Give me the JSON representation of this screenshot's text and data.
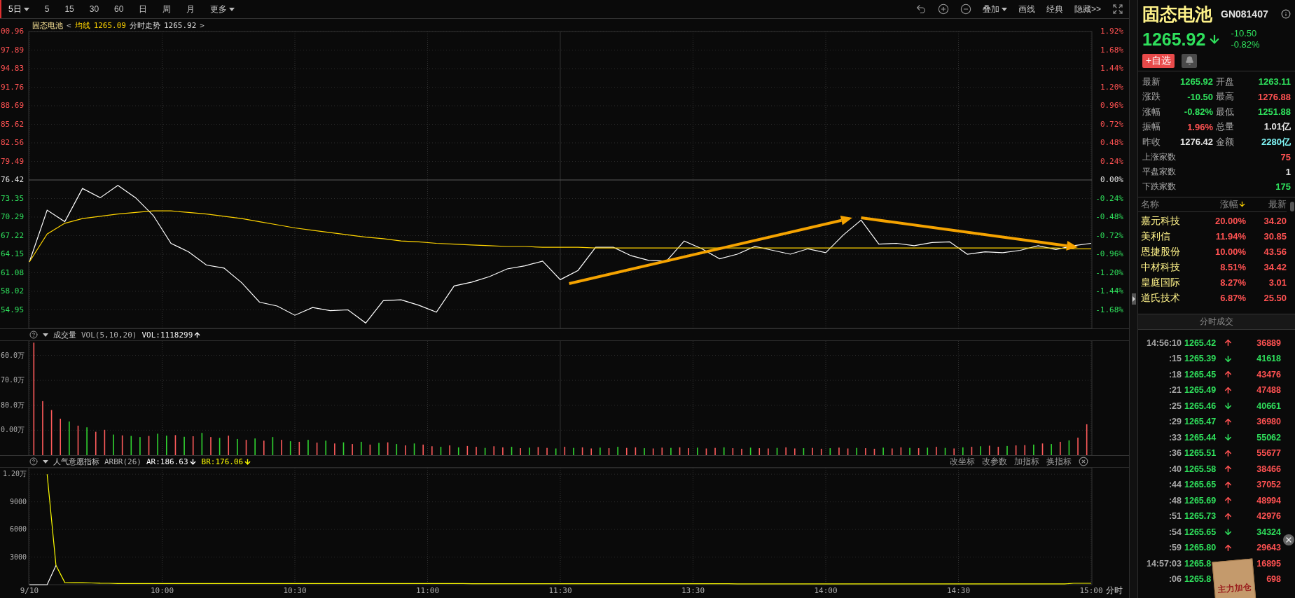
{
  "toolbar": {
    "periods": [
      {
        "label": "5日",
        "selected": true,
        "dropdown": true
      },
      {
        "label": "5",
        "selected": false,
        "dropdown": false
      },
      {
        "label": "15",
        "selected": false,
        "dropdown": false
      },
      {
        "label": "30",
        "selected": false,
        "dropdown": false
      },
      {
        "label": "60",
        "selected": false,
        "dropdown": false
      },
      {
        "label": "日",
        "selected": false,
        "dropdown": false
      },
      {
        "label": "周",
        "selected": false,
        "dropdown": false
      },
      {
        "label": "月",
        "selected": false,
        "dropdown": false
      },
      {
        "label": "更多",
        "selected": false,
        "dropdown": true
      }
    ],
    "tools": [
      {
        "kind": "undo"
      },
      {
        "kind": "zoom_in"
      },
      {
        "kind": "zoom_out"
      },
      {
        "kind": "text",
        "label": "叠加",
        "dropdown": true
      },
      {
        "kind": "text",
        "label": "画线",
        "dropdown": false
      },
      {
        "kind": "text",
        "label": "经典",
        "dropdown": false
      },
      {
        "kind": "text",
        "label": "隐藏>>",
        "dropdown": false
      },
      {
        "kind": "fullscreen"
      }
    ]
  },
  "main_chart": {
    "legend": {
      "name": "固态电池",
      "open": "<",
      "avg_value": "1265.09",
      "trend_value": "1265.92",
      "close": ">"
    },
    "price_labels": [
      "00.96",
      "97.89",
      "94.83",
      "91.76",
      "88.69",
      "85.62",
      "82.56",
      "79.49",
      "76.42",
      "73.35",
      "70.29",
      "67.22",
      "64.15",
      "61.08",
      "58.02",
      "54.95"
    ],
    "chart_data": {
      "type": "line",
      "grid": true,
      "ylim": [
        -1.92,
        1.92
      ],
      "yticks": [
        {
          "value": 1.92,
          "label": "1.92%"
        },
        {
          "value": 1.68,
          "label": "1.68%"
        },
        {
          "value": 1.44,
          "label": "1.44%"
        },
        {
          "value": 1.2,
          "label": "1.20%"
        },
        {
          "value": 0.96,
          "label": "0.96%"
        },
        {
          "value": 0.72,
          "label": "0.72%"
        },
        {
          "value": 0.48,
          "label": "0.48%"
        },
        {
          "value": 0.24,
          "label": "0.24%"
        },
        {
          "value": 0,
          "label": "0.00%"
        },
        {
          "value": -0.24,
          "label": "-0.24%"
        },
        {
          "value": -0.48,
          "label": "-0.48%"
        },
        {
          "value": -0.72,
          "label": "-0.72%"
        },
        {
          "value": -0.96,
          "label": "-0.96%"
        },
        {
          "value": -1.2,
          "label": "-1.20%"
        },
        {
          "value": -1.44,
          "label": "-1.44%"
        },
        {
          "value": -1.68,
          "label": "-1.68%"
        }
      ],
      "categories": [
        null,
        null,
        null,
        null,
        null,
        null,
        null,
        null,
        null,
        null,
        null,
        null,
        null,
        null,
        null,
        null,
        null,
        null,
        null,
        null,
        null,
        null,
        null,
        null,
        null,
        null,
        null,
        null,
        null,
        null,
        null,
        null,
        null,
        null,
        null,
        null,
        null,
        null,
        null,
        null,
        null,
        null,
        null,
        null,
        null,
        null,
        null,
        null,
        null,
        null,
        null,
        null,
        null,
        null,
        null,
        null,
        null,
        null,
        null,
        null,
        null
      ],
      "series": [
        {
          "name": "分时走势",
          "color": "#ffffff",
          "values": [
            -1.06,
            -0.39,
            -0.54,
            -0.11,
            -0.23,
            -0.07,
            -0.23,
            -0.46,
            -0.82,
            -0.93,
            -1.1,
            -1.14,
            -1.33,
            -1.58,
            -1.63,
            -1.75,
            -1.65,
            -1.69,
            -1.68,
            -1.85,
            -1.56,
            -1.55,
            -1.62,
            -1.71,
            -1.37,
            -1.32,
            -1.25,
            -1.15,
            -1.11,
            -1.05,
            -1.29,
            -1.17,
            -0.87,
            -0.87,
            -0.98,
            -1.04,
            -1.05,
            -0.79,
            -0.89,
            -1.02,
            -0.96,
            -0.86,
            -0.91,
            -0.96,
            -0.89,
            -0.94,
            -0.71,
            -0.52,
            -0.83,
            -0.82,
            -0.85,
            -0.81,
            -0.8,
            -0.96,
            -0.93,
            -0.94,
            -0.91,
            -0.85,
            -0.9,
            -0.85,
            -0.82
          ]
        },
        {
          "name": "均线",
          "color": "#ffd400",
          "values": [
            -1.06,
            -0.7,
            -0.56,
            -0.5,
            -0.47,
            -0.44,
            -0.42,
            -0.4,
            -0.4,
            -0.42,
            -0.44,
            -0.47,
            -0.5,
            -0.54,
            -0.58,
            -0.62,
            -0.65,
            -0.68,
            -0.71,
            -0.74,
            -0.76,
            -0.79,
            -0.8,
            -0.82,
            -0.83,
            -0.84,
            -0.85,
            -0.86,
            -0.86,
            -0.87,
            -0.87,
            -0.87,
            -0.88,
            -0.88,
            -0.88,
            -0.88,
            -0.88,
            -0.88,
            -0.88,
            -0.88,
            -0.88,
            -0.88,
            -0.88,
            -0.88,
            -0.88,
            -0.88,
            -0.88,
            -0.88,
            -0.88,
            -0.88,
            -0.88,
            -0.88,
            -0.88,
            -0.88,
            -0.88,
            -0.88,
            -0.88,
            -0.88,
            -0.88,
            -0.89,
            -0.89
          ]
        }
      ]
    }
  },
  "volume_panel": {
    "title": "成交量",
    "params": "VOL(5,10,20)",
    "reading": "VOL:1118299",
    "reading_rising": true,
    "axis_labels": [
      "60.0万",
      "70.0万",
      "80.0万",
      "0.00万"
    ]
  },
  "arbr_panel": {
    "title": "人气意愿指标",
    "params": "ARBR(26)",
    "readings": [
      {
        "text": "AR:186.63",
        "rising": false
      },
      {
        "text": "BR:176.06",
        "rising": false
      }
    ],
    "actions": [
      "改坐标",
      "改参数",
      "加指标",
      "换指标"
    ],
    "x_unit": "分时",
    "top_label": "1.20万",
    "chart_data": {
      "type": "line",
      "grid": true,
      "ylim": [
        0,
        12700
      ],
      "yticks": [
        9000,
        6000,
        3000
      ],
      "categories": [
        "9/10",
        null,
        null,
        null,
        null,
        null,
        null,
        null,
        null,
        null,
        null,
        null,
        null,
        null,
        null,
        "10:00",
        null,
        null,
        null,
        null,
        null,
        null,
        null,
        null,
        null,
        null,
        null,
        null,
        null,
        null,
        "10:30",
        null,
        null,
        null,
        null,
        null,
        null,
        null,
        null,
        null,
        null,
        null,
        null,
        null,
        null,
        "11:00",
        null,
        null,
        null,
        null,
        null,
        null,
        null,
        null,
        null,
        null,
        null,
        null,
        null,
        null,
        "11:30",
        null,
        null,
        null,
        null,
        null,
        null,
        null,
        null,
        null,
        null,
        null,
        null,
        null,
        null,
        "13:30",
        null,
        null,
        null,
        null,
        null,
        null,
        null,
        null,
        null,
        null,
        null,
        null,
        null,
        null,
        "14:00",
        null,
        null,
        null,
        null,
        null,
        null,
        null,
        null,
        null,
        null,
        null,
        null,
        null,
        null,
        "14:30",
        null,
        null,
        null,
        null,
        null,
        null,
        null,
        null,
        null,
        null,
        null,
        null,
        null,
        null,
        "15:00"
      ],
      "series": [
        {
          "color": "#ffff00",
          "values": [
            null,
            null,
            12000,
            2100,
            240,
            220,
            210,
            190,
            160,
            150,
            120,
            120,
            120,
            120,
            120,
            120,
            120,
            120,
            120,
            120,
            120,
            120,
            120,
            120,
            120,
            120,
            120,
            120,
            120,
            120,
            120,
            120,
            120,
            120,
            120,
            120,
            120,
            120,
            120,
            120,
            120,
            120,
            120,
            120,
            120,
            120,
            120,
            120,
            120,
            120,
            100,
            100,
            100,
            100,
            100,
            100,
            100,
            100,
            100,
            100,
            100,
            100,
            100,
            100,
            100,
            100,
            100,
            100,
            100,
            100,
            100,
            100,
            100,
            100,
            100,
            100,
            100,
            100,
            100,
            100,
            80,
            80,
            80,
            80,
            80,
            80,
            80,
            80,
            80,
            80,
            80,
            80,
            80,
            80,
            80,
            80,
            80,
            80,
            80,
            80,
            80,
            80,
            80,
            80,
            80,
            80,
            80,
            80,
            80,
            80,
            80,
            80,
            80,
            80,
            80,
            80,
            80,
            80,
            150,
            150,
            150
          ]
        },
        {
          "color": "#ffffff",
          "values": [
            0,
            0,
            0,
            2100,
            null,
            null,
            null,
            null,
            null,
            null,
            null,
            null,
            null,
            null,
            null,
            null,
            null,
            null,
            null,
            null,
            null,
            null,
            null,
            null,
            null,
            null,
            null,
            null,
            null,
            null,
            null,
            null,
            null,
            null,
            null,
            null,
            null,
            null,
            null,
            null,
            null,
            null,
            null,
            null,
            null,
            null,
            null,
            null,
            null,
            null,
            null,
            null,
            null,
            null,
            null,
            null,
            null,
            null,
            null,
            null,
            null,
            null,
            null,
            null,
            null,
            null,
            null,
            null,
            null,
            null,
            null,
            null,
            null,
            null,
            null,
            null,
            null,
            null,
            null,
            null,
            null,
            null,
            null,
            null,
            null,
            null,
            null,
            null,
            null,
            null,
            null,
            null,
            null,
            null,
            null,
            null,
            null,
            null,
            null,
            null,
            null,
            null,
            null,
            null,
            null,
            null,
            null,
            null,
            null,
            null,
            null,
            null,
            null,
            null,
            null,
            null,
            null,
            null,
            null,
            null,
            null
          ]
        }
      ]
    }
  },
  "quote": {
    "name": "固态电池",
    "code": "GN081407",
    "price": "1265.92",
    "rising": false,
    "change": "-10.50",
    "change_pct": "-0.82%",
    "watch_button": "+自选"
  },
  "stats": [
    {
      "label": "最新",
      "value": "1265.92",
      "color": "#2fe05c"
    },
    {
      "label": "开盘",
      "value": "1263.11",
      "color": "#2fe05c"
    },
    {
      "label": "涨跌",
      "value": "-10.50",
      "color": "#2fe05c"
    },
    {
      "label": "最高",
      "value": "1276.88",
      "color": "#ff5252"
    },
    {
      "label": "涨幅",
      "value": "-0.82%",
      "color": "#2fe05c"
    },
    {
      "label": "最低",
      "value": "1251.88",
      "color": "#2fe05c"
    },
    {
      "label": "振幅",
      "value": "1.96%",
      "color": "#ff5252"
    },
    {
      "label": "总量",
      "value": "1.01亿",
      "color": "#e6e6e6"
    },
    {
      "label": "昨收",
      "value": "1276.42",
      "color": "#e6e6e6"
    },
    {
      "label": "金额",
      "value": "2280亿",
      "color": "#7ff5f5"
    }
  ],
  "breadth": [
    {
      "label": "上涨家数",
      "value": "75",
      "color": "#ff5252"
    },
    {
      "label": "平盘家数",
      "value": "1",
      "color": "#e6e6e6"
    },
    {
      "label": "下跌家数",
      "value": "175",
      "color": "#2fe05c"
    }
  ],
  "constituents": {
    "columns": [
      {
        "label": "名称",
        "sorted": false
      },
      {
        "label": "涨幅",
        "sorted": true
      },
      {
        "label": "最新",
        "sorted": false
      }
    ],
    "rows": [
      {
        "name": "嘉元科技",
        "pct": "20.00%",
        "last": "34.20"
      },
      {
        "name": "美利信",
        "pct": "11.94%",
        "last": "30.85"
      },
      {
        "name": "恩捷股份",
        "pct": "10.00%",
        "last": "43.56"
      },
      {
        "name": "中材科技",
        "pct": "8.51%",
        "last": "34.42"
      },
      {
        "name": "皇庭国际",
        "pct": "8.27%",
        "last": "3.01"
      },
      {
        "name": "道氏技术",
        "pct": "6.87%",
        "last": "25.50"
      }
    ]
  },
  "trades": {
    "title": "分时成交",
    "rows": [
      {
        "time": "14:56:10",
        "price": "1265.42",
        "rising": true,
        "arrow_shown": true,
        "volume": "36889"
      },
      {
        "time": ":15",
        "price": "1265.39",
        "rising": false,
        "arrow_shown": true,
        "volume": "41618"
      },
      {
        "time": ":18",
        "price": "1265.45",
        "rising": true,
        "arrow_shown": true,
        "volume": "43476"
      },
      {
        "time": ":21",
        "price": "1265.49",
        "rising": true,
        "arrow_shown": true,
        "volume": "47488"
      },
      {
        "time": ":25",
        "price": "1265.46",
        "rising": false,
        "arrow_shown": true,
        "volume": "40661"
      },
      {
        "time": ":29",
        "price": "1265.47",
        "rising": true,
        "arrow_shown": true,
        "volume": "36980"
      },
      {
        "time": ":33",
        "price": "1265.44",
        "rising": false,
        "arrow_shown": true,
        "volume": "55062"
      },
      {
        "time": ":36",
        "price": "1265.51",
        "rising": true,
        "arrow_shown": true,
        "volume": "55677"
      },
      {
        "time": ":40",
        "price": "1265.58",
        "rising": true,
        "arrow_shown": true,
        "volume": "38466"
      },
      {
        "time": ":44",
        "price": "1265.65",
        "rising": true,
        "arrow_shown": true,
        "volume": "37052"
      },
      {
        "time": ":48",
        "price": "1265.69",
        "rising": true,
        "arrow_shown": true,
        "volume": "48994"
      },
      {
        "time": ":51",
        "price": "1265.73",
        "rising": true,
        "arrow_shown": true,
        "volume": "42976"
      },
      {
        "time": ":54",
        "price": "1265.65",
        "rising": false,
        "arrow_shown": true,
        "volume": "34324"
      },
      {
        "time": ":59",
        "price": "1265.80",
        "rising": true,
        "arrow_shown": true,
        "volume": "29643"
      },
      {
        "time": "14:57:03",
        "price": "1265.8",
        "rising": true,
        "arrow_shown": false,
        "volume": "16895"
      },
      {
        "time": ":06",
        "price": "1265.8",
        "rising": true,
        "arrow_shown": false,
        "volume": "698"
      }
    ]
  },
  "promo": {
    "text": "主力加仓"
  }
}
